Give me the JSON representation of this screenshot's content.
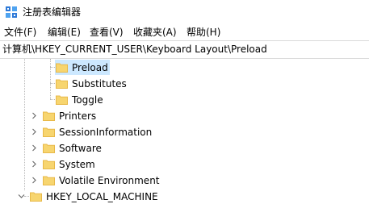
{
  "window": {
    "title": "注册表编辑器",
    "icon": "regedit-icon"
  },
  "menu": {
    "items": [
      {
        "label": "文件(F)"
      },
      {
        "label": "编辑(E)"
      },
      {
        "label": "查看(V)"
      },
      {
        "label": "收藏夹(A)"
      },
      {
        "label": "帮助(H)"
      }
    ]
  },
  "address": {
    "path": "计算机\\HKEY_CURRENT_USER\\Keyboard Layout\\Preload"
  },
  "tree": {
    "items": [
      {
        "label": "Preload",
        "expanded": false,
        "selected": true
      },
      {
        "label": "Substitutes",
        "expanded": false,
        "selected": false
      },
      {
        "label": "Toggle",
        "expanded": false,
        "selected": false
      },
      {
        "label": "Printers",
        "expanded": false,
        "selected": false
      },
      {
        "label": "SessionInformation",
        "expanded": false,
        "selected": false
      },
      {
        "label": "Software",
        "expanded": false,
        "selected": false
      },
      {
        "label": "System",
        "expanded": false,
        "selected": false
      },
      {
        "label": "Volatile Environment",
        "expanded": false,
        "selected": false
      },
      {
        "label": "HKEY_LOCAL_MACHINE",
        "expanded": true,
        "selected": false
      }
    ]
  },
  "colors": {
    "folder": "#f7d56f",
    "folder_dark": "#e8b94a",
    "selection": "#cce8ff",
    "chevron": "#6d6d6d"
  }
}
